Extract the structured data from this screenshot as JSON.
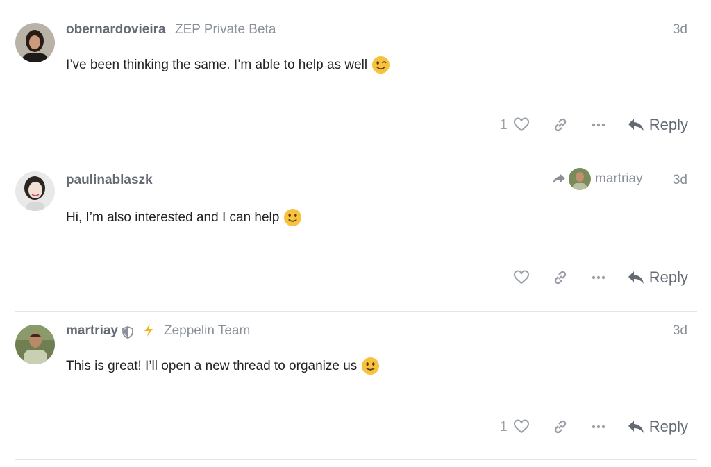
{
  "posts": [
    {
      "username": "obernardovieira",
      "group": "ZEP Private Beta",
      "date": "3d",
      "body": "I’ve been thinking the same. I’m able to help as well",
      "emoji": "wink-emoji",
      "like_count": "1",
      "reply_label": "Reply"
    },
    {
      "username": "paulinablaszk",
      "reply_to": "martriay",
      "date": "3d",
      "body": "Hi, I’m also interested and I can help",
      "emoji": "smile-emoji",
      "like_count": "",
      "reply_label": "Reply"
    },
    {
      "username": "martriay",
      "group": "Zeppelin Team",
      "date": "3d",
      "body": "This is great! I’ll open a new thread to organize us",
      "emoji": "smile-emoji",
      "like_count": "1",
      "reply_label": "Reply"
    }
  ],
  "colors": {
    "muted": "#8a9099",
    "username": "#646a73",
    "emoji_face": "#f7c23d",
    "bolt": "#f0b429"
  }
}
